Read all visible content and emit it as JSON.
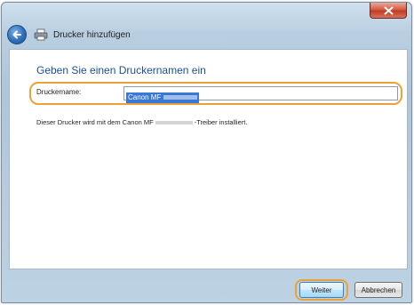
{
  "window": {
    "title": "Drucker hinzufügen",
    "close_icon": "close-icon"
  },
  "content": {
    "heading": "Geben Sie einen Druckernamen ein",
    "name_label": "Druckername:",
    "name_value": "Canon MF",
    "info_prefix": "Dieser Drucker wird mit dem Canon MF",
    "info_suffix": "-Treiber installiert."
  },
  "footer": {
    "next_label": "Weiter",
    "cancel_label": "Abbrechen"
  },
  "colors": {
    "heading": "#1b4e9c",
    "highlight": "#eaa238",
    "selection": "#3a78d8",
    "close": "#c23d23"
  }
}
